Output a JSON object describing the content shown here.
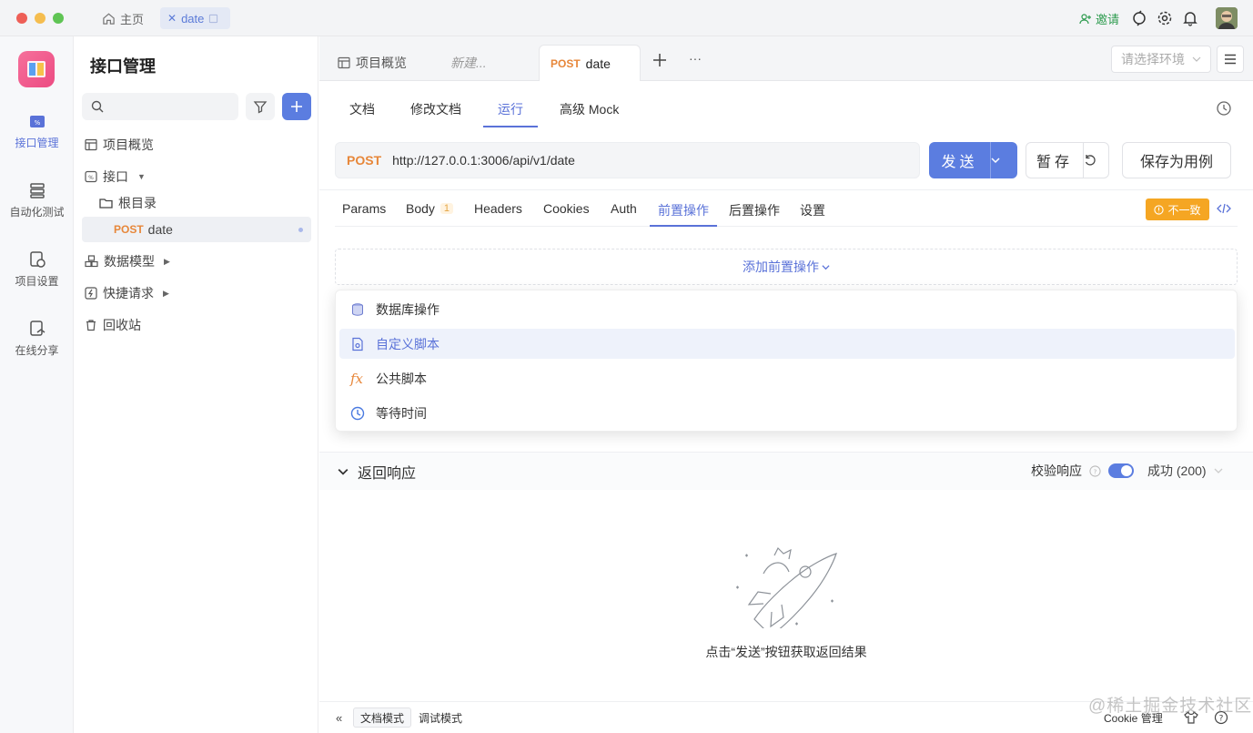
{
  "titlebar": {
    "tabs": [
      {
        "label": "主页"
      },
      {
        "label": "date"
      }
    ],
    "invite_label": "邀请"
  },
  "rail": {
    "items": [
      {
        "label": "接口管理",
        "active": true
      },
      {
        "label": "自动化测试"
      },
      {
        "label": "项目设置"
      },
      {
        "label": "在线分享"
      }
    ]
  },
  "tree": {
    "title": "接口管理",
    "items": {
      "overview": "项目概览",
      "api": "接口",
      "root_dir": "根目录",
      "endpoint_method": "POST",
      "endpoint_name": "date",
      "models": "数据模型",
      "quick": "快捷请求",
      "trash": "回收站"
    }
  },
  "doc_tabs": {
    "overview": "项目概览",
    "new_placeholder": "新建...",
    "active_method": "POST",
    "active_name": "date",
    "more": "···"
  },
  "env_select": {
    "placeholder": "请选择环境"
  },
  "sub_tabs": [
    "文档",
    "修改文档",
    "运行",
    "高级 Mock"
  ],
  "request": {
    "method": "POST",
    "url": "http://127.0.0.1:3006/api/v1/date",
    "send_label": "发送",
    "save_temp_label": "暂存",
    "save_case_label": "保存为用例"
  },
  "req_tabs": {
    "params": "Params",
    "body": "Body",
    "body_count": "1",
    "headers": "Headers",
    "cookies": "Cookies",
    "auth": "Auth",
    "pre": "前置操作",
    "post": "后置操作",
    "settings": "设置",
    "mismatch": "不一致"
  },
  "pre_ops": {
    "add_label": "添加前置操作",
    "menu": [
      "数据库操作",
      "自定义脚本",
      "公共脚本",
      "等待时间"
    ],
    "highlighted": "自定义脚本"
  },
  "response": {
    "title": "返回响应",
    "verify_label": "校验响应",
    "verify_on": true,
    "status": "成功 (200)",
    "empty_hint": "点击“发送”按钮获取返回结果"
  },
  "bottom": {
    "doc_mode": "文档模式",
    "debug_mode": "调试模式",
    "cookie_label": "Cookie 管理"
  },
  "watermark": "@稀土掘金技术社区",
  "colors": {
    "accent": "#5b7de0",
    "method_post": "#e7873a",
    "warning": "#f5a623",
    "invite": "#2f9c50"
  }
}
